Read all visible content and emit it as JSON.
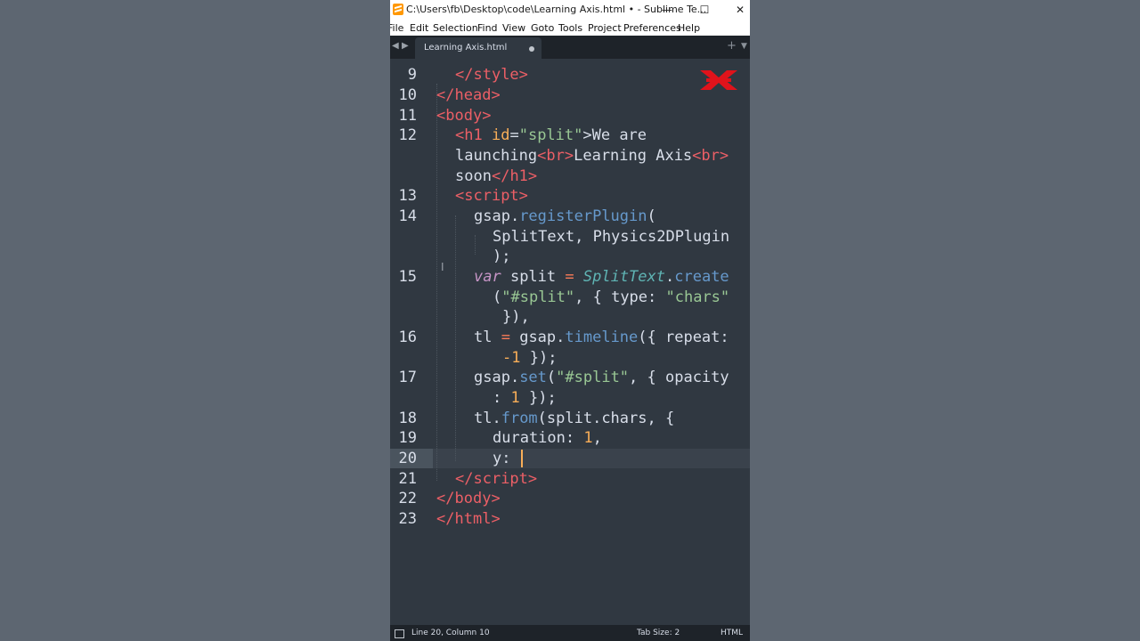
{
  "window": {
    "title": "C:\\Users\\fb\\Desktop\\code\\Learning Axis.html • - Sublime Te...",
    "controls": {
      "minimize": "—",
      "maximize": "☐",
      "close": "✕"
    }
  },
  "menu": [
    "File",
    "Edit",
    "Selection",
    "Find",
    "View",
    "Goto",
    "Tools",
    "Project",
    "Preferences",
    "Help"
  ],
  "tabs": {
    "arrows": {
      "left": "◀",
      "right": "▶"
    },
    "active": {
      "label": "Learning Axis.html",
      "modified": true
    },
    "new_tab": "+",
    "dropdown": "▼"
  },
  "editor": {
    "line_numbers": [
      "9",
      "10",
      "11",
      "12",
      "13",
      "14",
      "15",
      "16",
      "17",
      "18",
      "19",
      "20",
      "21",
      "22",
      "23"
    ],
    "current_line": "20",
    "code": {
      "r0": [
        "</",
        "style",
        ">"
      ],
      "r1": [
        "</",
        "head",
        ">"
      ],
      "r2": [
        "<",
        "body",
        ">"
      ],
      "r3": [
        "<",
        "h1",
        " ",
        "id",
        "=",
        "\"split\"",
        ">We are"
      ],
      "r4": [
        "launching",
        "<",
        "br",
        ">",
        "Learning Axis",
        "<",
        "br",
        ">"
      ],
      "r5": [
        "soon",
        "</",
        "h1",
        ">"
      ],
      "r6": [
        "<",
        "script",
        ">"
      ],
      "r7": [
        "gsap.",
        "registerPlugin",
        "("
      ],
      "r8": [
        "SplitText, Physics2DPlugin"
      ],
      "r9": [
        ");"
      ],
      "r10": [
        "var",
        " split ",
        "=",
        " ",
        "SplitText",
        ".",
        "create"
      ],
      "r11": [
        "(",
        "\"#split\"",
        ", { type: ",
        "\"chars\""
      ],
      "r12": [
        "}),"
      ],
      "r13": [
        "tl ",
        "=",
        " gsap.",
        "timeline",
        "({ repeat:"
      ],
      "r14": [
        "-1",
        " });"
      ],
      "r15": [
        "gsap.",
        "set",
        "(",
        "\"#split\"",
        ", { opacity"
      ],
      "r16": [
        ": ",
        "1",
        " });"
      ],
      "r17": [
        "tl.",
        "from",
        "(split.chars, {"
      ],
      "r18": [
        "duration: ",
        "1",
        ","
      ],
      "r19": [
        "y: "
      ],
      "r20": [
        "</",
        "script",
        ">"
      ],
      "r21": [
        "</",
        "body",
        ">"
      ],
      "r22": [
        "</",
        "html",
        ">"
      ]
    }
  },
  "status": {
    "position": "Line 20, Column 10",
    "tab_size": "Tab Size: 2",
    "syntax": "HTML"
  },
  "colors": {
    "background": "#5d6671",
    "editor_bg": "#303841",
    "tag": "#ec5f66",
    "string": "#99c794",
    "function": "#6699cc",
    "keyword": "#c695c6",
    "number": "#f9ae58",
    "logo": "#e0131b"
  }
}
